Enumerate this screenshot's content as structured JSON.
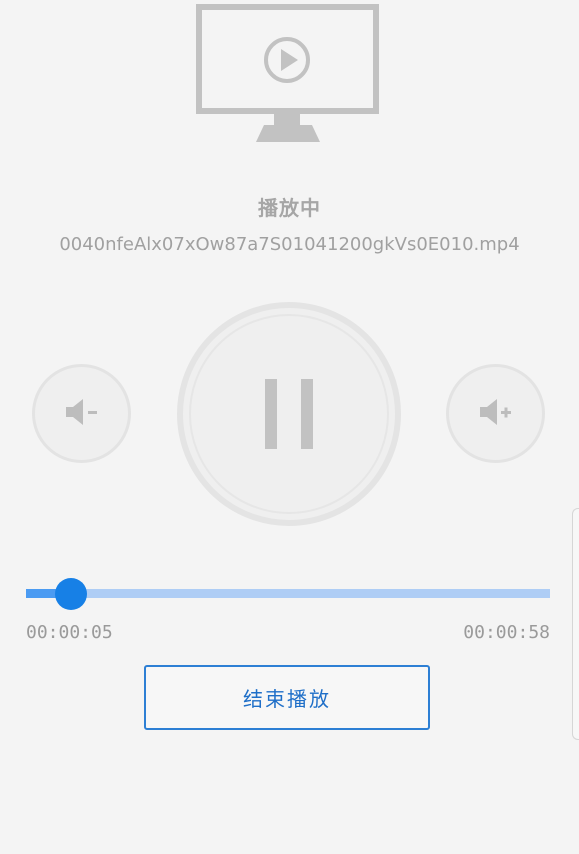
{
  "player": {
    "status_label": "播放中",
    "filename": "0040nfeAlx07xOw87a7S01041200gkVs0E010.mp4"
  },
  "progress": {
    "current_time": "00:00:05",
    "total_time": "00:00:58",
    "fraction": 0.086
  },
  "actions": {
    "stop_label": "结束播放"
  },
  "icons": {
    "monitor": "monitor-play-icon",
    "volume_down": "volume-down-icon",
    "volume_up": "volume-up-icon",
    "pause": "pause-icon"
  },
  "colors": {
    "accent": "#1780e6",
    "track": "#aecdf5",
    "stop_button_border": "#2d7fd4",
    "icon_gray": "#bdbdbd",
    "background": "#f4f4f4"
  }
}
